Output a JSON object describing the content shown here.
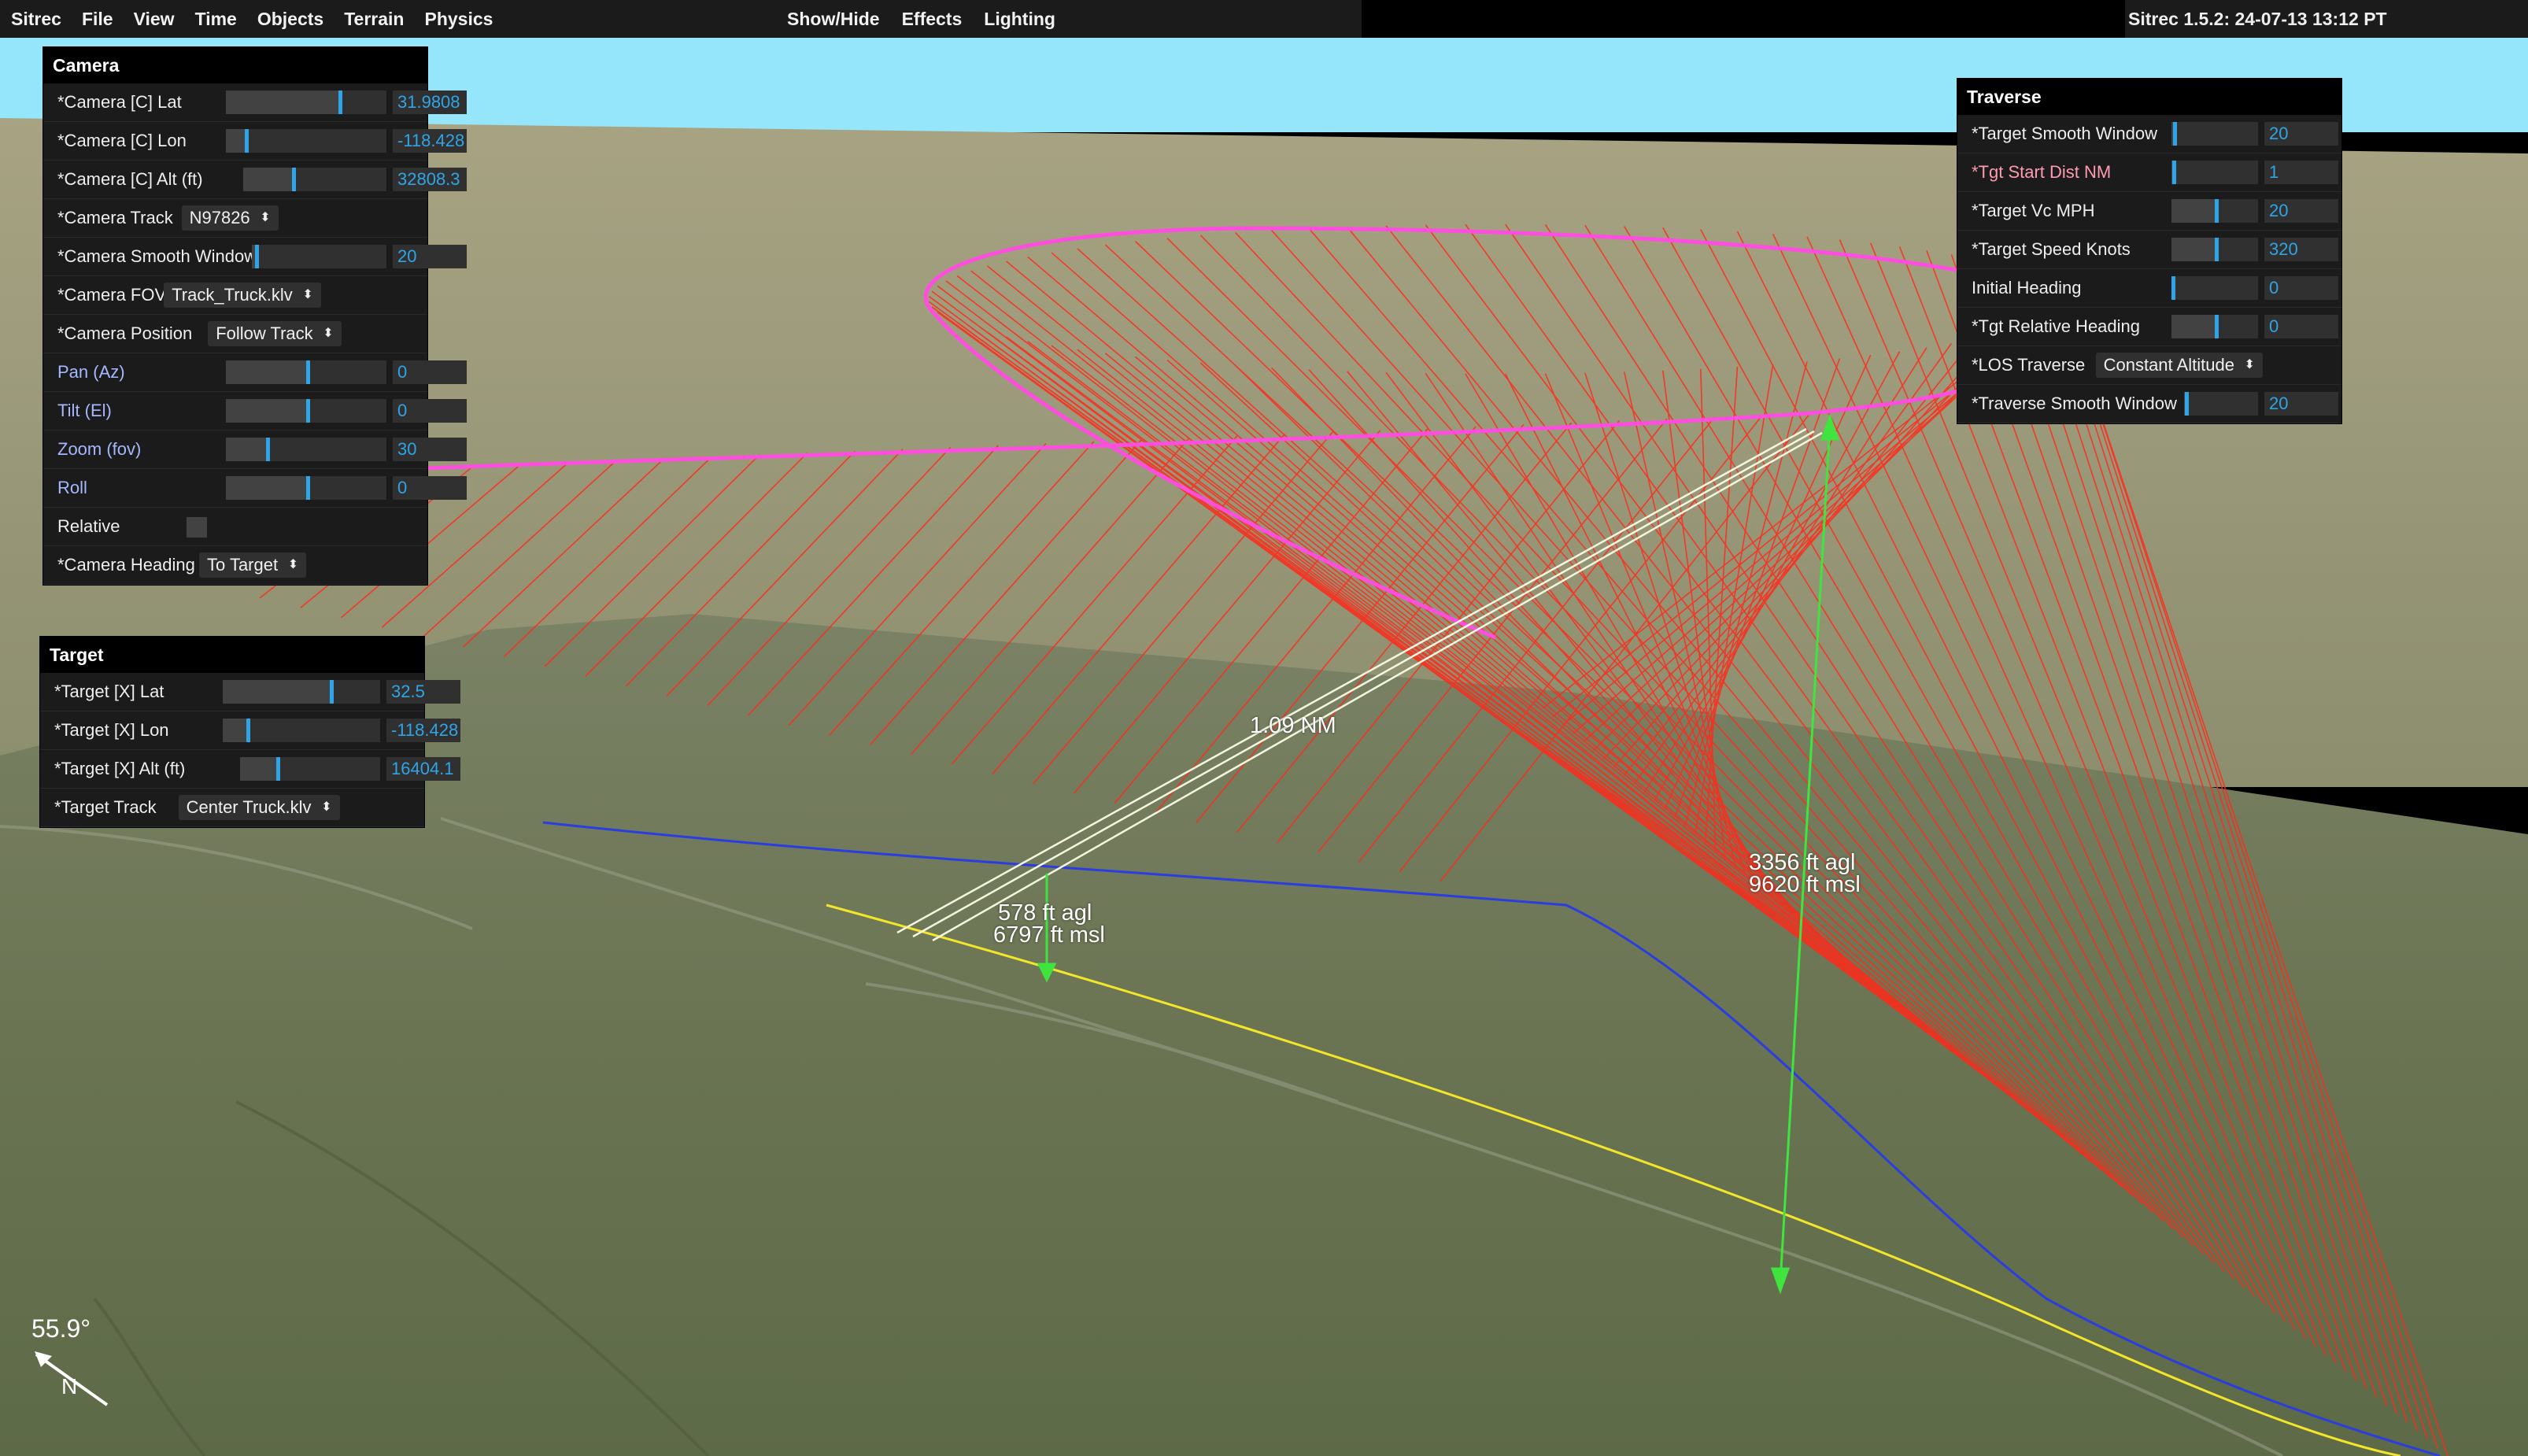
{
  "menu": {
    "left": [
      "Sitrec",
      "File",
      "View",
      "Time",
      "Objects",
      "Terrain",
      "Physics"
    ],
    "center": [
      "Show/Hide",
      "Effects",
      "Lighting"
    ],
    "version": "Sitrec 1.5.2: 24-07-13 13:12 PT"
  },
  "camera_panel": {
    "title": "Camera",
    "rows": [
      {
        "label": "*Camera [C] Lat",
        "type": "slider",
        "value": "31.9808",
        "level": 0.7
      },
      {
        "label": "*Camera [C] Lon",
        "type": "slider",
        "value": "-118.428",
        "level": 0.12
      },
      {
        "label": "*Camera [C] Alt (ft)",
        "type": "slider",
        "value": "32808.3",
        "level": 0.34
      },
      {
        "label": "*Camera Track",
        "type": "select",
        "value": "N97826"
      },
      {
        "label": "*Camera Smooth Window",
        "type": "slider",
        "value": "20",
        "level": 0.02
      },
      {
        "label": "*Camera FOV",
        "type": "select",
        "value": "Track_Truck.klv"
      },
      {
        "label": "*Camera Position",
        "type": "select",
        "value": "Follow Track"
      },
      {
        "label": "Pan (Az)",
        "type": "slider",
        "value": "0",
        "level": 0.5,
        "color": "blue"
      },
      {
        "label": "Tilt (El)",
        "type": "slider",
        "value": "0",
        "level": 0.5,
        "color": "blue"
      },
      {
        "label": "Zoom (fov)",
        "type": "slider",
        "value": "30",
        "level": 0.25,
        "color": "blue"
      },
      {
        "label": "Roll",
        "type": "slider",
        "value": "0",
        "level": 0.5,
        "color": "blue"
      },
      {
        "label": "Relative",
        "type": "checkbox"
      },
      {
        "label": "*Camera Heading",
        "type": "select",
        "value": "To Target"
      }
    ]
  },
  "target_panel": {
    "title": "Target",
    "rows": [
      {
        "label": "*Target [X] Lat",
        "type": "slider",
        "value": "32.5",
        "level": 0.68
      },
      {
        "label": "*Target [X] Lon",
        "type": "slider",
        "value": "-118.428",
        "level": 0.15
      },
      {
        "label": "*Target [X] Alt (ft)",
        "type": "slider",
        "value": "16404.1",
        "level": 0.26
      },
      {
        "label": "*Target Track",
        "type": "select",
        "value": "Center Truck.klv"
      }
    ]
  },
  "traverse_panel": {
    "title": "Traverse",
    "rows": [
      {
        "label": "*Target Smooth Window",
        "type": "slider",
        "value": "20",
        "level": 0.02
      },
      {
        "label": "*Tgt Start Dist NM",
        "type": "slider",
        "value": "1",
        "level": 0.01,
        "color": "pink"
      },
      {
        "label": "*Target Vc MPH",
        "type": "slider",
        "value": "20",
        "level": 0.5
      },
      {
        "label": "*Target Speed Knots",
        "type": "slider",
        "value": "320",
        "level": 0.5
      },
      {
        "label": "Initial Heading",
        "type": "slider",
        "value": "0",
        "level": 0.0
      },
      {
        "label": "*Tgt Relative Heading",
        "type": "slider",
        "value": "0",
        "level": 0.5
      },
      {
        "label": "*LOS Traverse",
        "type": "select",
        "value": "Constant Altitude"
      },
      {
        "label": "*Traverse Smooth Window",
        "type": "slider",
        "value": "20",
        "level": 0.02
      }
    ]
  },
  "scene": {
    "distance_label": "1.09 NM",
    "near_agl": "578 ft agl",
    "near_msl": "6797 ft msl",
    "far_agl": "3356 ft agl",
    "far_msl": "9620 ft msl",
    "compass_angle": "55.9°",
    "north_label": "N"
  },
  "colors": {
    "sky": "#96e6fb",
    "far_plain": "#9a9878",
    "terrain": "#6f7a55",
    "los_lines": "#ff2a1a",
    "traverse_curve": "#ff4de0",
    "accent": "#2fa4e7"
  }
}
